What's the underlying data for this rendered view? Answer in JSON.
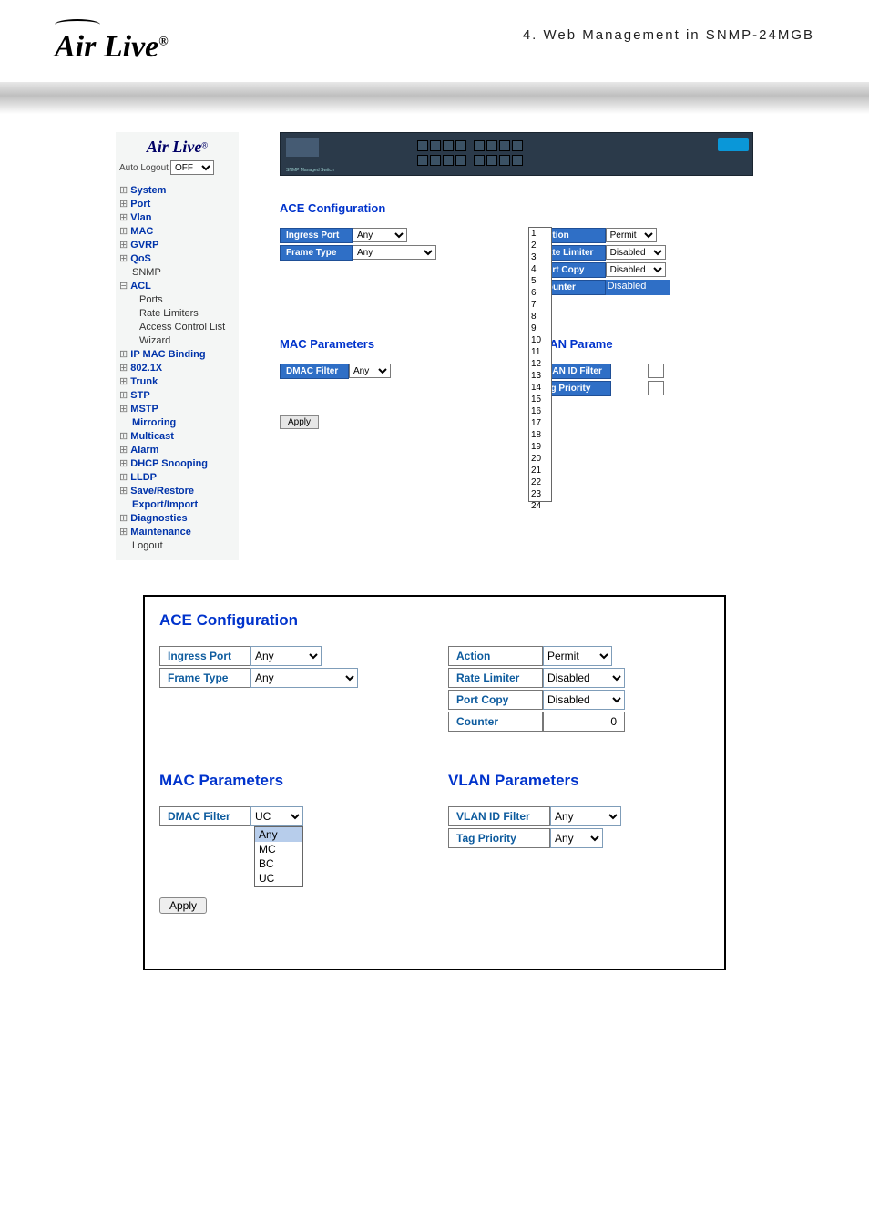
{
  "header": {
    "chapter": "4.  Web  Management  in  SNMP-24MGB"
  },
  "brand": {
    "name": "Air Live",
    "reg": "®"
  },
  "sidebar": {
    "autologout_label": "Auto Logout",
    "autologout_value": "OFF",
    "nav": {
      "system": "System",
      "port": "Port",
      "vlan": "Vlan",
      "mac": "MAC",
      "gvrp": "GVRP",
      "qos": "QoS",
      "snmp": "SNMP",
      "acl": "ACL",
      "acl_ports": "Ports",
      "acl_ratelimiters": "Rate Limiters",
      "acl_accesslist": "Access Control List",
      "acl_wizard": "Wizard",
      "ipmac": "IP MAC Binding",
      "dot1x": "802.1X",
      "trunk": "Trunk",
      "stp": "STP",
      "mstp": "MSTP",
      "mirroring": "Mirroring",
      "multicast": "Multicast",
      "alarm": "Alarm",
      "dhcps": "DHCP Snooping",
      "lldp": "LLDP",
      "saverestore": "Save/Restore",
      "expimp": "Export/Import",
      "diag": "Diagnostics",
      "maint": "Maintenance",
      "logout": "Logout"
    }
  },
  "shot1": {
    "title": "ACE Configuration",
    "ingress_label": "Ingress Port",
    "ingress_value": "Any",
    "frame_label": "Frame Type",
    "frame_value": "Any",
    "action_label": "Action",
    "action_value": "Permit",
    "ratelim_label": "Rate Limiter",
    "ratelim_value": "Disabled",
    "portcopy_label": "Port Copy",
    "portcopy_value": "Disabled",
    "counter_label": "Counter",
    "counter_value": "Disabled",
    "mac_title": "MAC Parameters",
    "dmac_label": "DMAC Filter",
    "dmac_value": "Any",
    "vlan_title": "VLAN Parameters",
    "vlan_title_cut": "VLAN Parame",
    "vlanid_label": "VLAN ID Filter",
    "tagpri_label": "Tag Priority",
    "apply": "Apply",
    "droplist": [
      "1",
      "2",
      "3",
      "4",
      "5",
      "6",
      "7",
      "8",
      "9",
      "10",
      "11",
      "12",
      "13",
      "14",
      "15",
      "16",
      "17",
      "18",
      "19",
      "20",
      "21",
      "22",
      "23",
      "24"
    ]
  },
  "shot2": {
    "title": "ACE Configuration",
    "ingress_label": "Ingress Port",
    "ingress_value": "Any",
    "frame_label": "Frame Type",
    "frame_value": "Any",
    "action_label": "Action",
    "action_value": "Permit",
    "ratelim_label": "Rate Limiter",
    "ratelim_value": "Disabled",
    "portcopy_label": "Port Copy",
    "portcopy_value": "Disabled",
    "counter_label": "Counter",
    "counter_value": "0",
    "mac_title": "MAC Parameters",
    "dmac_label": "DMAC Filter",
    "dmac_value": "UC",
    "dmac_options": [
      "Any",
      "MC",
      "BC",
      "UC"
    ],
    "vlan_title": "VLAN Parameters",
    "vlanid_label": "VLAN ID Filter",
    "vlanid_value": "Any",
    "tagpri_label": "Tag Priority",
    "tagpri_value": "Any",
    "apply": "Apply"
  }
}
